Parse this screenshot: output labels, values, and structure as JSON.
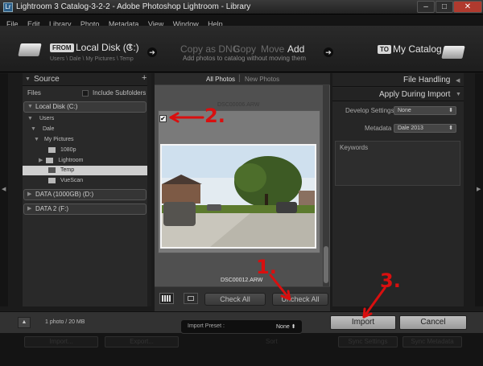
{
  "window": {
    "title": "Lightroom 3 Catalog-3-2-2 - Adobe Photoshop Lightroom - Library",
    "app_icon": "Lr"
  },
  "menu": [
    "File",
    "Edit",
    "Library",
    "Photo",
    "Metadata",
    "View",
    "Window",
    "Help"
  ],
  "header": {
    "from_badge": "FROM",
    "source": "Local Disk (C:)",
    "source_path": "Users \\ Dale \\ My Pictures \\ Temp",
    "modes": [
      "Copy as DNG",
      "Copy",
      "Move",
      "Add"
    ],
    "active_mode": "Add",
    "mode_description": "Add photos to catalog without moving them",
    "to_badge": "TO",
    "destination": "My Catalog"
  },
  "source_panel": {
    "title": "Source",
    "files_label": "Files",
    "include_subfolders": "Include Subfolders",
    "drives": [
      "Local Disk (C:)",
      "DATA (1000GB) (D:)",
      "DATA 2 (F:)"
    ],
    "tree": [
      "Users",
      "Dale",
      "My Pictures",
      "1080p",
      "Lightroom",
      "Temp",
      "VueScan"
    ]
  },
  "grid": {
    "tabs": [
      "All Photos",
      "New Photos"
    ],
    "top_filename": "DSC00006.ARW",
    "filename": "DSC00012.ARW",
    "check_all": "Check All",
    "uncheck_all": "Uncheck All"
  },
  "right_panel": {
    "file_handling": "File Handling",
    "apply_title": "Apply During Import",
    "develop_label": "Develop Settings",
    "develop_value": "None",
    "metadata_label": "Metadata",
    "metadata_value": "Dale 2013",
    "keywords_label": "Keywords"
  },
  "footer": {
    "summary": "1 photo / 20 MB",
    "preset_label": "Import Preset :",
    "preset_value": "None",
    "import": "Import",
    "cancel": "Cancel",
    "ghost_import": "Import...",
    "ghost_export": "Export...",
    "ghost_sort": "Sort",
    "ghost_sync_settings": "Sync Settings",
    "ghost_sync_meta": "Sync Metadata"
  },
  "annotations": {
    "one": "1.",
    "two": "2.",
    "three": "3.",
    "color": "#d90f0f"
  }
}
